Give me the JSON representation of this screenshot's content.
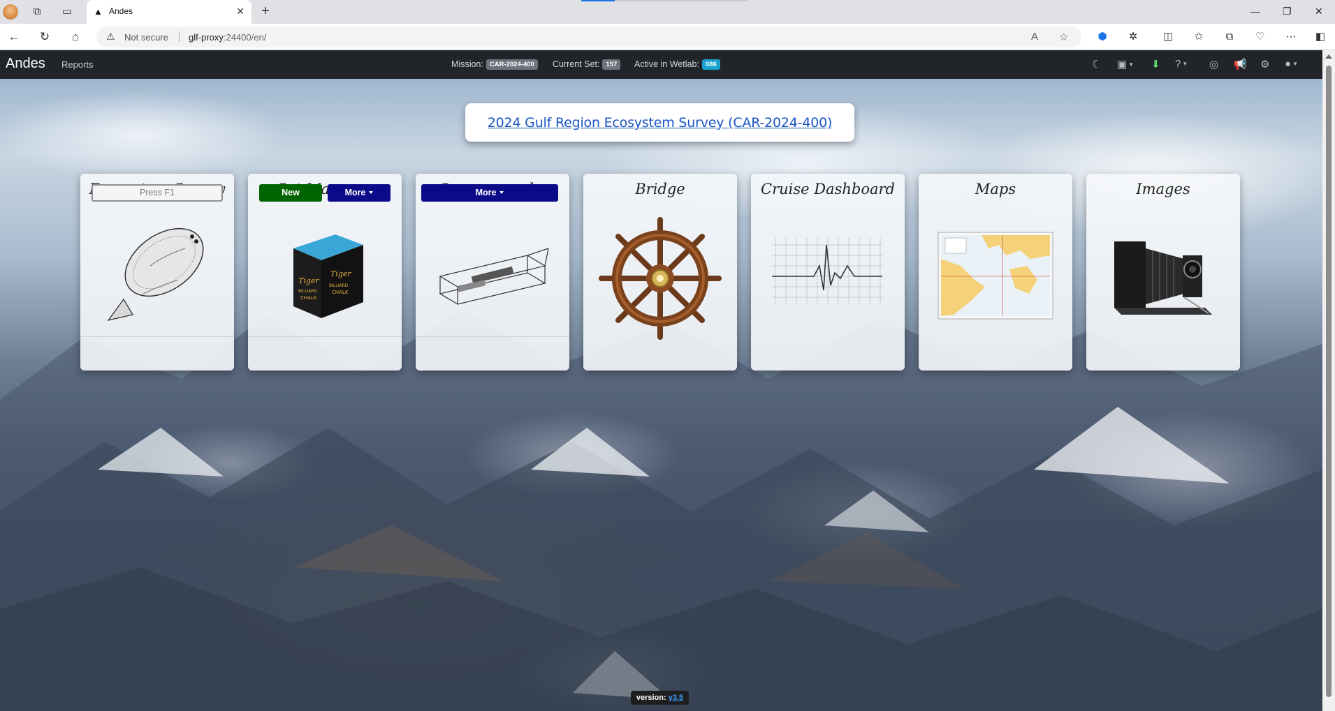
{
  "browser": {
    "tab_title": "Andes",
    "address": {
      "security_text": "Not secure",
      "host": "glf-proxy",
      "path": ":24400/en/"
    }
  },
  "app": {
    "brand": "Andes",
    "nav": {
      "reports_label": "Reports",
      "mission_label": "Mission:",
      "mission_value": "CAR-2024-400",
      "current_set_label": "Current Set:",
      "current_set_value": "157",
      "wetlab_label": "Active in Wetlab:",
      "wetlab_value": "086"
    },
    "banner_link": "2024 Gulf Region Ecosystem Survey (CAR-2024-400)",
    "cards": [
      {
        "title": "Ecosystem Survey",
        "icon": "flounder-fish-icon",
        "button": "Press F1"
      },
      {
        "title": "Set Manager",
        "icon": "chalk-cube-icon",
        "new_button": "New",
        "more_button": "More"
      },
      {
        "title": "Oceanography",
        "icon": "ctd-rosette-icon",
        "more_button": "More"
      },
      {
        "title": "Bridge",
        "icon": "ships-wheel-icon"
      },
      {
        "title": "Cruise Dashboard",
        "icon": "heartbeat-chart-icon"
      },
      {
        "title": "Maps",
        "icon": "nautical-chart-icon"
      },
      {
        "title": "Images",
        "icon": "vintage-camera-icon"
      }
    ],
    "chalk_text": {
      "brand": "Tiger",
      "line1": "BILLIARD",
      "line2": "CHALK"
    },
    "version": {
      "label": "version:",
      "value": "v3.5"
    }
  },
  "colors": {
    "navbar": "#212529",
    "btn_green": "#006400",
    "btn_navy": "#0b0b8a",
    "badge_gray": "#6c757d",
    "badge_cyan": "#17a2d0",
    "link": "#1a55c4"
  }
}
